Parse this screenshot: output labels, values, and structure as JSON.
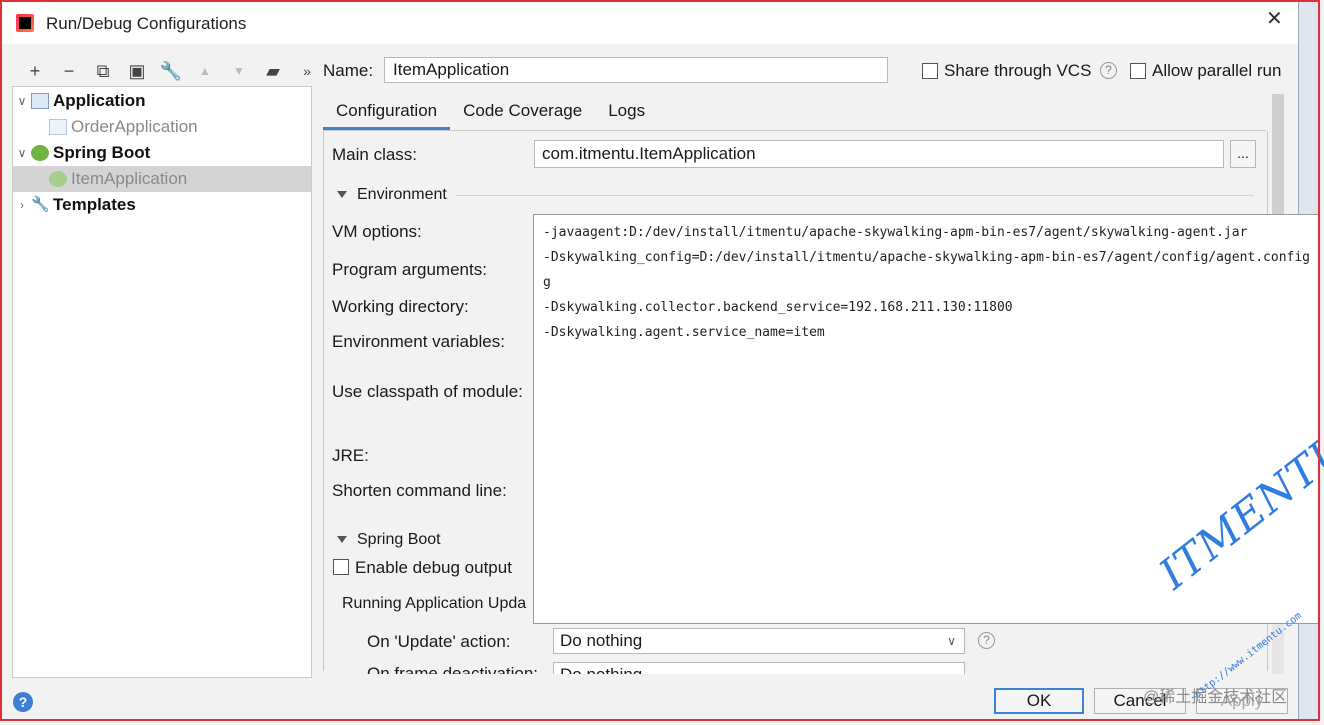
{
  "window": {
    "title": "Run/Debug Configurations",
    "close": "✕"
  },
  "toolbar": {
    "add": "+",
    "remove": "−",
    "copy": "⧉",
    "save": "▣",
    "edit": "🔧",
    "up": "▲",
    "down": "▼",
    "folder": "▰",
    "more": "»"
  },
  "tree": {
    "items": [
      {
        "label": "Application",
        "expanded": true
      },
      {
        "label": "OrderApplication"
      },
      {
        "label": "Spring Boot",
        "expanded": true
      },
      {
        "label": "ItemApplication",
        "selected": true
      },
      {
        "label": "Templates",
        "expanded": false
      }
    ]
  },
  "name": {
    "label": "Name:",
    "value": "ItemApplication"
  },
  "share": {
    "label": "Share through VCS",
    "checked": false,
    "help": "?"
  },
  "parallel": {
    "label": "Allow parallel run",
    "checked": false
  },
  "tabs": [
    {
      "label": "Configuration",
      "active": true
    },
    {
      "label": "Code Coverage"
    },
    {
      "label": "Logs"
    }
  ],
  "config": {
    "main_class_label": "Main class:",
    "main_class_value": "com.itmentu.ItemApplication",
    "browse": "...",
    "environment_section": "Environment",
    "vm_options_label": "VM options:",
    "program_args_label": "Program arguments:",
    "working_dir_label": "Working directory:",
    "env_vars_label": "Environment variables:",
    "classpath_label": "Use classpath of module:",
    "jre_label": "JRE:",
    "shorten_label": "Shorten command line:",
    "spring_boot_section": "Spring Boot",
    "debug_output_label": "Enable debug output",
    "running_updates_label": "Running Application Upda",
    "on_update_label": "On 'Update' action:",
    "on_update_value": "Do nothing",
    "on_frame_label": "On frame deactivation:",
    "on_frame_value": "Do nothing",
    "help": "?"
  },
  "vm_popup": {
    "lines": [
      "-javaagent:D:/dev/install/itmentu/apache-skywalking-apm-bin-es7/agent/skywalking-agent.jar",
      "-Dskywalking_config=D:/dev/install/itmentu/apache-skywalking-apm-bin-es7/agent/config/agent.config",
      "g",
      "-Dskywalking.collector.backend_service=192.168.211.130:11800",
      "-Dskywalking.agent.service_name=item"
    ]
  },
  "buttons": {
    "help": "?",
    "ok": "OK",
    "cancel": "Cancel",
    "apply": "Apply"
  },
  "watermark": {
    "big": "ITMENTU",
    "small": "http://www.itmentu.com",
    "site": "@稀土掘金技术社区"
  },
  "colors": {
    "accent": "#4083c9",
    "frame": "#e0303a",
    "watermark": "#2f7de0"
  }
}
